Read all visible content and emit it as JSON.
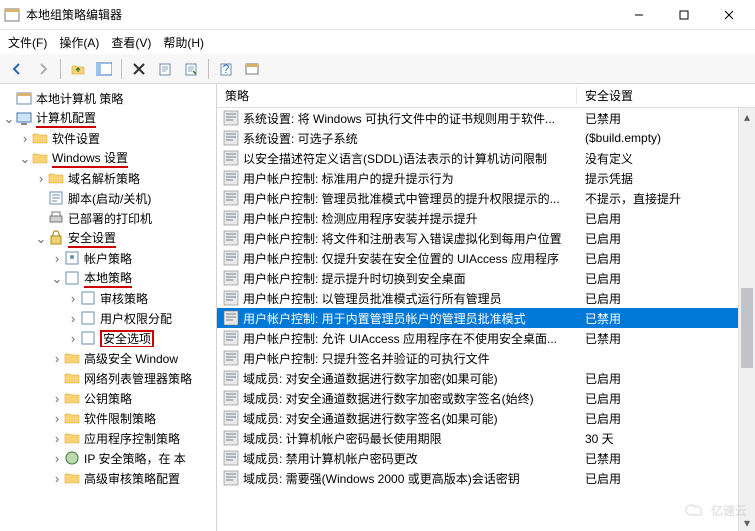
{
  "window": {
    "title": "本地组策略编辑器"
  },
  "menu": {
    "file": "文件(F)",
    "action": "操作(A)",
    "view": "查看(V)",
    "help": "帮助(H)"
  },
  "tree": {
    "root": "本地计算机 策略",
    "comp_config": "计算机配置",
    "software": "软件设置",
    "windows": "Windows 设置",
    "dns": "域名解析策略",
    "scripts": "脚本(启动/关机)",
    "printers": "已部署的打印机",
    "security": "安全设置",
    "account_pol": "帐户策略",
    "local_pol": "本地策略",
    "audit_pol": "审核策略",
    "user_rights": "用户权限分配",
    "sec_options": "安全选项",
    "firewall": "高级安全 Window",
    "nlmgr": "网络列表管理器策略",
    "pubkey": "公钥策略",
    "swrestrict": "软件限制策略",
    "appctrl": "应用程序控制策略",
    "ipsec": "IP 安全策略，在 本",
    "advaudit": "高级审核策略配置"
  },
  "list": {
    "col_policy": "策略",
    "col_setting": "安全设置",
    "rows": [
      {
        "p": "系统设置: 将 Windows 可执行文件中的证书规则用于软件...",
        "s": "已禁用"
      },
      {
        "p": "系统设置: 可选子系统",
        "s": "($build.empty)"
      },
      {
        "p": "以安全描述符定义语言(SDDL)语法表示的计算机访问限制",
        "s": "没有定义"
      },
      {
        "p": "用户帐户控制: 标准用户的提升提示行为",
        "s": "提示凭据"
      },
      {
        "p": "用户帐户控制: 管理员批准模式中管理员的提升权限提示的...",
        "s": "不提示，直接提升"
      },
      {
        "p": "用户帐户控制: 检测应用程序安装并提示提升",
        "s": "已启用"
      },
      {
        "p": "用户帐户控制: 将文件和注册表写入错误虚拟化到每用户位置",
        "s": "已启用"
      },
      {
        "p": "用户帐户控制: 仅提升安装在安全位置的 UIAccess 应用程序",
        "s": "已启用"
      },
      {
        "p": "用户帐户控制: 提示提升时切换到安全桌面",
        "s": "已启用"
      },
      {
        "p": "用户帐户控制: 以管理员批准模式运行所有管理员",
        "s": "已启用"
      },
      {
        "p": "用户帐户控制: 用于内置管理员帐户的管理员批准模式",
        "s": "已禁用",
        "sel": true
      },
      {
        "p": "用户帐户控制: 允许 UIAccess 应用程序在不使用安全桌面...",
        "s": "已禁用"
      },
      {
        "p": "用户帐户控制: 只提升签名并验证的可执行文件",
        "s": ""
      },
      {
        "p": "域成员: 对安全通道数据进行数字加密(如果可能)",
        "s": "已启用"
      },
      {
        "p": "域成员: 对安全通道数据进行数字加密或数字签名(始终)",
        "s": "已启用"
      },
      {
        "p": "域成员: 对安全通道数据进行数字签名(如果可能)",
        "s": "已启用"
      },
      {
        "p": "域成员: 计算机帐户密码最长使用期限",
        "s": "30 天"
      },
      {
        "p": "域成员: 禁用计算机帐户密码更改",
        "s": "已禁用"
      },
      {
        "p": "域成员: 需要强(Windows 2000 或更高版本)会话密钥",
        "s": "已启用"
      }
    ]
  },
  "watermark": "亿速云"
}
